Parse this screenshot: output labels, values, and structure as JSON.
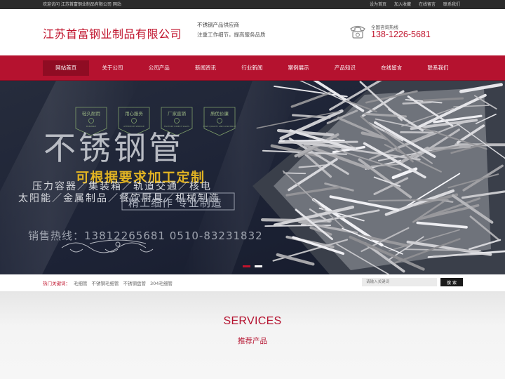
{
  "topbar": {
    "welcome": "欢迎访问 江苏首富钢业制品有限公司 网站",
    "links": [
      "设为首页",
      "加入收藏",
      "在线留言",
      "联系我们"
    ]
  },
  "header": {
    "company_name": "江苏首富钢业制品有限公司",
    "slogan_line1": "不锈钢产品供应商",
    "slogan_line2": "注重工作细节，提高服务品质",
    "hotline_label": "全国咨询热线",
    "hotline_number": "138-1226-5681"
  },
  "nav": {
    "items": [
      "网站首页",
      "关于公司",
      "公司产品",
      "新闻资讯",
      "行业新闻",
      "案例展示",
      "产品知识",
      "在线留言",
      "联系我们"
    ],
    "active_index": 0
  },
  "banner": {
    "badges": [
      {
        "title": "轻久耐用",
        "sub": "DURABLE"
      },
      {
        "title": "用心服务",
        "sub": "ATTENTIVE SERVICE"
      },
      {
        "title": "厂家直销",
        "sub": "FACTORY DIRECT SALES"
      },
      {
        "title": "质优价廉",
        "sub": "HIGH QUALITY AND LOW PRICE"
      }
    ],
    "headline": "不锈钢管",
    "subheadline": "可根据要求加工定制",
    "applications_line1": "压力容器／集装箱／轨道交通／核电",
    "applications_line2": "太阳能／金属制品／餐饮厨具／机械制造",
    "quality_tag": "精工细作  专业制造",
    "sales_hotline": "销售热线：13812265681    0510-83231832",
    "slide_count": 2,
    "active_slide": 0
  },
  "keywords": {
    "label": "热门关键词：",
    "items": [
      "毛细管",
      "不锈钢毛细管",
      "不锈钢盘管",
      "304毛细管"
    ]
  },
  "search": {
    "placeholder": "请输入关键词",
    "button": "搜 索"
  },
  "services": {
    "title_en": "SERVICES",
    "title_zh": "推荐产品"
  },
  "colors": {
    "brand_red": "#b5122f",
    "nav_active": "#8f0c23",
    "topbar_bg": "#2b2b2b",
    "banner_bg": "#1b2133"
  }
}
